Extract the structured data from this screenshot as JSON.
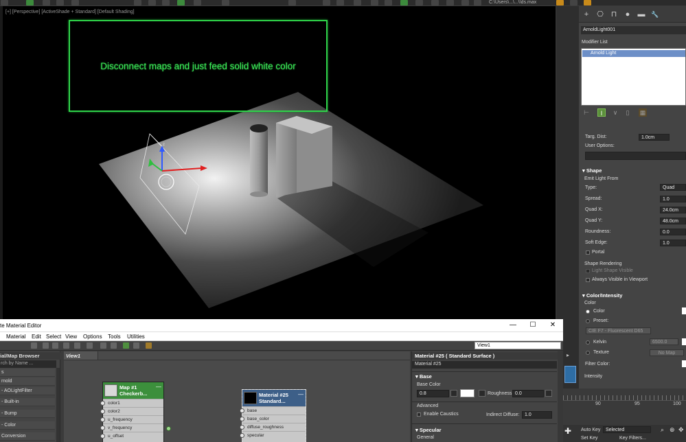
{
  "top_toolbar": {
    "file_path": "C:\\Users\\...\\...\\\\ds.max"
  },
  "viewport": {
    "label": "[+] [Perspective] [ActiveShade + Standard] [Default Shading]",
    "callout_text": "Disconnect maps and just feed solid white color",
    "callout_color": "#2fd34a"
  },
  "command_panel": {
    "tabs": [
      "+",
      "⎔",
      "⊓",
      "●",
      "▬",
      "🔧"
    ],
    "object_name": "ArnoldLight001",
    "modifier_list_label": "Modifier List",
    "modifier_items": [
      "Arnold Light"
    ],
    "targ_dist_label": "Targ. Dist:",
    "targ_dist_value": "1.0cm",
    "user_options_label": "User Options:",
    "shape": {
      "title": "Shape",
      "emit_label": "Emit Light From",
      "type_label": "Type:",
      "type_value": "Quad",
      "spread_label": "Spread:",
      "spread_value": "1.0",
      "quad_x_label": "Quad X:",
      "quad_x_value": "24.0cm",
      "quad_y_label": "Quad Y:",
      "quad_y_value": "48.0cm",
      "roundness_label": "Roundness:",
      "roundness_value": "0.0",
      "soft_edge_label": "Soft Edge:",
      "soft_edge_value": "1.0",
      "portal_label": "Portal",
      "rendering_label": "Shape Rendering",
      "light_shape_visible_label": "Light Shape Visible",
      "always_visible_label": "Always Visible in Viewport"
    },
    "color_intensity": {
      "title": "Color/Intensity",
      "color_label": "Color",
      "color_radio_label": "Color",
      "preset_label": "Preset:",
      "preset_value": "CIE F7 - Fluorescent D65",
      "kelvin_label": "Kelvin",
      "kelvin_value": "6500.0",
      "texture_label": "Texture",
      "texture_button": "No Map",
      "filter_color_label": "Filter Color:",
      "intensity_label": "Intensity"
    }
  },
  "timeline": {
    "ticks": [
      "90",
      "95",
      "100"
    ]
  },
  "bottom_bar": {
    "auto_key_label": "Auto Key",
    "auto_key_value": "Selected",
    "set_key_label": "Set Key",
    "key_filters_label": "Key Filters..."
  },
  "material_editor": {
    "title": "te Material Editor",
    "window_controls": [
      "—",
      "☐",
      "✕"
    ],
    "menus": [
      "Material",
      "Edit",
      "Select",
      "View",
      "Options",
      "Tools",
      "Utilities"
    ],
    "view_dropdown": "View1",
    "browser": {
      "title": "ial/Map Browser",
      "search_placeholder": "rch by Name ...",
      "items": [
        "s",
        "rnold",
        "- AOLightFilter",
        "- Built-in",
        "- Bump",
        "- Color",
        "Conversion"
      ]
    },
    "node_view": {
      "tab": "View1",
      "nodes": [
        {
          "title_line1": "Map #1",
          "title_line2": "Checkerb...",
          "slots": [
            "color1",
            "color2",
            "u_frequency",
            "v_frequency",
            "u_offset"
          ]
        },
        {
          "title_line1": "Material #25",
          "title_line2": "Standard...",
          "slots": [
            "base",
            "base_color",
            "diffuse_roughness",
            "specular"
          ]
        }
      ]
    },
    "params": {
      "header": "Material #25  ( Standard Surface )",
      "name_field": "Material #25",
      "base_section": "Base",
      "base_color_label": "Base Color",
      "base_weight": "0.8",
      "roughness_label": "Roughness:",
      "roughness_value": "0.0",
      "advanced_label": "Advanced",
      "enable_caustics_label": "Enable Caustics",
      "indirect_diffuse_label": "Indirect Diffuse:",
      "indirect_diffuse_value": "1.0",
      "specular_section": "Specular",
      "general_label": "General"
    }
  }
}
